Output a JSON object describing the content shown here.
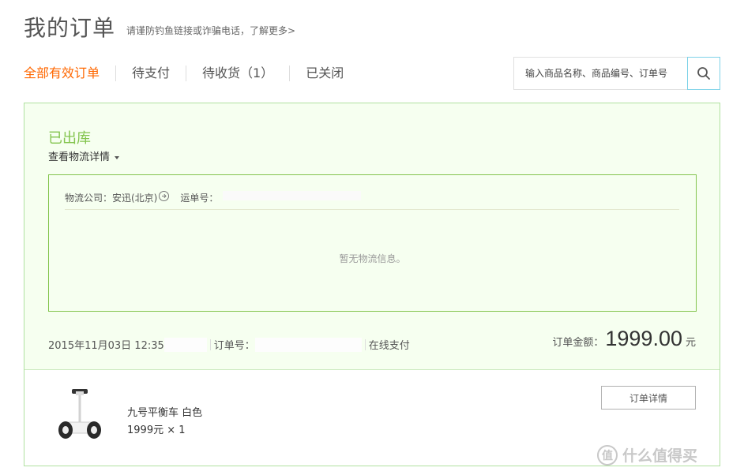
{
  "page": {
    "title": "我的订单",
    "notice": "请谨防钓鱼链接或诈骗电话，了解更多>"
  },
  "tabs": [
    {
      "label": "全部有效订单",
      "active": true
    },
    {
      "label": "待支付",
      "active": false
    },
    {
      "label": "待收货（1）",
      "active": false
    },
    {
      "label": "已关闭",
      "active": false
    }
  ],
  "search": {
    "placeholder": "输入商品名称、商品编号、订单号",
    "icon": "search-icon"
  },
  "order": {
    "status": "已出库",
    "logistics_toggle": "查看物流详情",
    "logistics": {
      "company_text": "物流公司：安迅(北京)",
      "tracking_label": "运单号：",
      "empty_message": "暂无物流信息。"
    },
    "datetime": "2015年11月03日 12:35",
    "order_no_label": "订单号：",
    "payment_method": "在线支付",
    "amount_label": "订单金额：",
    "amount_value": "1999.00",
    "amount_unit": "元",
    "items": [
      {
        "name": "九号平衡车 白色",
        "price_qty": "1999元 × 1"
      }
    ],
    "detail_button": "订单详情"
  },
  "watermark": {
    "logo": "值",
    "text": "什么值得买"
  },
  "colors": {
    "accent": "#ff6700",
    "status_green": "#83c44e",
    "panel_bg": "#f6fff0",
    "panel_border": "#b0e1a0"
  }
}
